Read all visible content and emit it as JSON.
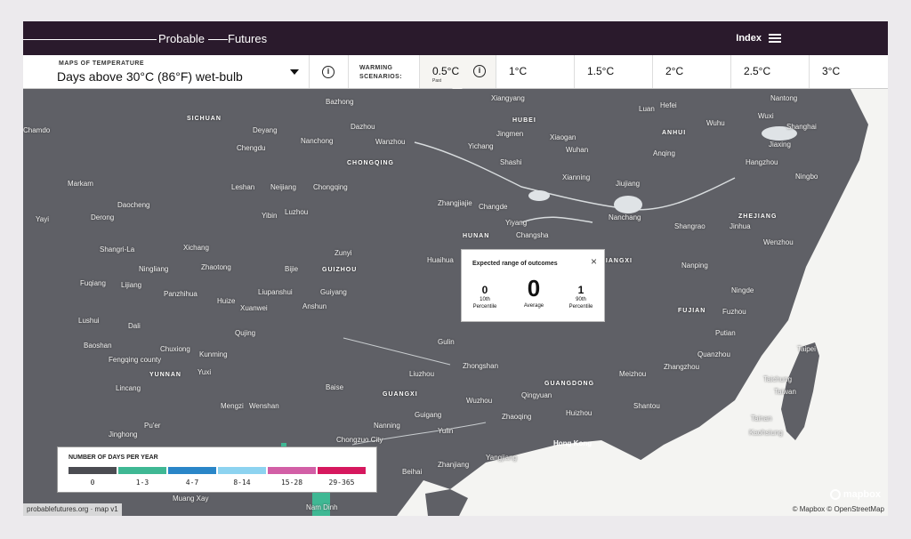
{
  "header": {
    "logo_left": "Probable",
    "logo_right": "Futures",
    "index_label": "Index"
  },
  "controls": {
    "map_kicker": "MAPS OF TEMPERATURE",
    "map_title": "Days above 30°C (86°F) wet-bulb",
    "info_icon": "i",
    "warming_label": "WARMING SCENARIOS:",
    "scenarios": [
      {
        "label": "0.5°C",
        "sub": "Past"
      },
      {
        "label": "1°C"
      },
      {
        "label": "1.5°C"
      },
      {
        "label": "2°C"
      },
      {
        "label": "2.5°C"
      },
      {
        "label": "3°C"
      }
    ],
    "active_scenario": "0.5°C"
  },
  "popup": {
    "title": "Expected range of outcomes",
    "close": "×",
    "low_value": "0",
    "low_label_1": "10th",
    "low_label_2": "Percentile",
    "avg_value": "0",
    "avg_label": "Average",
    "high_value": "1",
    "high_label_1": "90th",
    "high_label_2": "Percentile"
  },
  "legend": {
    "title": "NUMBER OF DAYS PER YEAR",
    "items": [
      {
        "label": "0",
        "color": "#4b4c52"
      },
      {
        "label": "1-3",
        "color": "#3fb894"
      },
      {
        "label": "4-7",
        "color": "#2a86c8"
      },
      {
        "label": "8-14",
        "color": "#8dd3f0"
      },
      {
        "label": "15-28",
        "color": "#d25fa6"
      },
      {
        "label": "29-365",
        "color": "#d6185e"
      }
    ]
  },
  "map": {
    "provinces": [
      "SICHUAN",
      "HUBEI",
      "ANHUI",
      "CHONGQING",
      "ZHEJIANG",
      "HUNAN",
      "JIANGXI",
      "GUIZHOU",
      "FUJIAN",
      "YUNNAN",
      "GUANGDONG",
      "GUANGXI"
    ],
    "cities": [
      "Bazhong",
      "Xiangyang",
      "Nantong",
      "Dazhou",
      "Luan",
      "Hefei",
      "Wuxi",
      "Chamdo",
      "Deyang",
      "Nanchong",
      "Wanzhou",
      "Jingmen",
      "Xiaogan",
      "Wuhu",
      "Shanghai",
      "Chengdu",
      "Yichang",
      "Wuhan",
      "Anqing",
      "Jiaxing",
      "Shashi",
      "Hangzhou",
      "Markam",
      "Leshan",
      "Neijiang",
      "Chongqing",
      "Xianning",
      "Jiujiang",
      "Ningbo",
      "Daocheng",
      "Zhangjiajie",
      "Changde",
      "Yibin",
      "Luzhou",
      "Nanchang",
      "Shangrao",
      "Yayi",
      "Derong",
      "Yiyang",
      "Changsha",
      "Jinhua",
      "Wenzhou",
      "Shangri-La",
      "Xichang",
      "Zunyi",
      "Huaihua",
      "Fuqiang",
      "Ningliang",
      "Lijiang",
      "Zhaotong",
      "Bijie",
      "Nanping",
      "Panzhihua",
      "Liupanshui",
      "Guiyang",
      "Ningde",
      "Huize",
      "Xuanwei",
      "Anshun",
      "Fuzhou",
      "Lushui",
      "Dali",
      "Putian",
      "Qujing",
      "Baoshan",
      "Chuxiong",
      "Kunming",
      "Gulin",
      "Quanzhou",
      "Fengqing county",
      "Yuxi",
      "Liuzhou",
      "Zhongshan",
      "Meizhou",
      "Zhangzhou",
      "Taichung",
      "Taipei",
      "Lincang",
      "Baise",
      "Qingyuan",
      "Taiwan",
      "Mengzi",
      "Wenshan",
      "Wuzhou",
      "Shantou",
      "Tainan",
      "Pu'er",
      "Nanning",
      "Guigang",
      "Zhaoqing",
      "Huizhou",
      "Kaohsiung",
      "Jinghong",
      "Yulin",
      "Hong Kong",
      "Chongzuo City",
      "Beihai",
      "Yangjiang",
      "Zhanjiang",
      "Muang Xay",
      "Nam Dinh"
    ]
  },
  "attribution": {
    "left": "probablefutures.org · map v1",
    "right": "© Mapbox © OpenStreetMap",
    "mapbox": "mapbox"
  },
  "colors": {
    "topbar": "#2a1a2c",
    "land": "#5f6066",
    "sea": "#f4f4f2"
  }
}
